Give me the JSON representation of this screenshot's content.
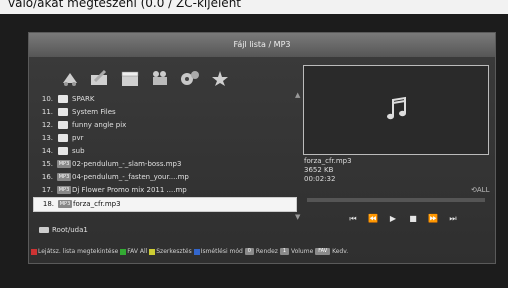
{
  "top_caption": "való/akat megteszeni (0.0 / ZC-kijelent",
  "window": {
    "title": "Fájl lista / MP3"
  },
  "categories": [
    {
      "name": "music-icon"
    },
    {
      "name": "picture-icon"
    },
    {
      "name": "movie-icon"
    },
    {
      "name": "record-icon"
    },
    {
      "name": "settings-icon"
    },
    {
      "name": "favorites-icon"
    }
  ],
  "file_list": [
    {
      "num": "10.",
      "type": "folder",
      "label": "SPARK"
    },
    {
      "num": "11.",
      "type": "folder",
      "label": "System Files"
    },
    {
      "num": "12.",
      "type": "folder",
      "label": "funny angle pix"
    },
    {
      "num": "13.",
      "type": "folder",
      "label": "pvr"
    },
    {
      "num": "14.",
      "type": "folder",
      "label": "sub"
    },
    {
      "num": "15.",
      "type": "mp3",
      "label": "02-pendulum_-_slam-boss.mp3"
    },
    {
      "num": "16.",
      "type": "mp3",
      "label": "04-pendulum_-_fasten_your....mp"
    },
    {
      "num": "17.",
      "type": "mp3",
      "label": "Dj Flower Promo mix 2011 ....mp"
    },
    {
      "num": "18.",
      "type": "mp3",
      "label": "forza_cfr.mp3",
      "selected": true
    }
  ],
  "mp3_badge": "MP3",
  "preview": {
    "icon": "music-note-icon"
  },
  "file_info": {
    "name": "forza_cfr.mp3",
    "size": "3652 KB",
    "duration": "00:02:32"
  },
  "repeat_mode": "ALL",
  "playback_progress": 0,
  "controls": [
    {
      "name": "skip-previous-icon",
      "glyph": "⏮"
    },
    {
      "name": "rewind-icon",
      "glyph": "◀◀"
    },
    {
      "name": "play-icon",
      "glyph": "▶"
    },
    {
      "name": "stop-icon",
      "glyph": "■"
    },
    {
      "name": "fast-forward-icon",
      "glyph": "▶▶"
    },
    {
      "name": "skip-next-icon",
      "glyph": "⏭"
    }
  ],
  "path": "Root/uda1",
  "footer": {
    "red": "Lejátsz. lista megtekintése",
    "green": "FAV All",
    "yellow": "Szerkesztés",
    "blue": "Ismétlési mód",
    "key0": "0",
    "sort": "Rendez",
    "key1": "1",
    "volume": "Volume",
    "fav": "FAV",
    "kedv": "Kedv."
  },
  "colors": {
    "panel_bg": "#353535",
    "selected_row": "#f4f4f4",
    "text": "#e0e0e0"
  }
}
